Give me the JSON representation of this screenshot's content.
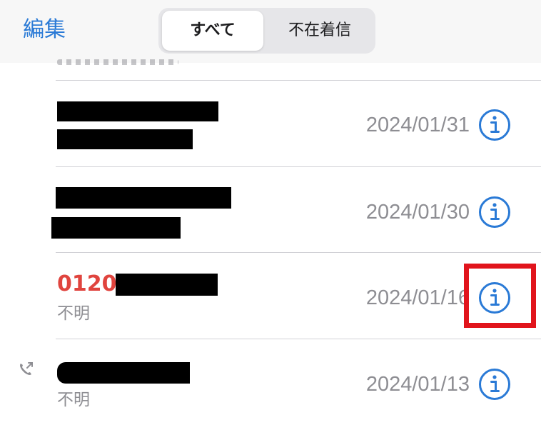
{
  "nav": {
    "edit_label": "編集",
    "segments": [
      "すべて",
      "不在着信"
    ],
    "selected": "すべて"
  },
  "rows": [
    {
      "name": "",
      "subtitle": "",
      "date": "2024/01/31"
    },
    {
      "name": "",
      "subtitle": "",
      "date": "2024/01/30"
    },
    {
      "name": "0120",
      "subtitle": "不明",
      "date": "2024/01/16",
      "missed": true
    },
    {
      "name": "",
      "subtitle": "不明",
      "date": "2024/01/13",
      "outgoing": true
    }
  ],
  "colors": {
    "accent": "#2a7ad6",
    "missed": "#e0443e",
    "secondary_text": "#8e8e93",
    "highlight": "#e1141c"
  },
  "icons": {
    "info": "info-circle-icon",
    "outgoing": "outgoing-call-icon"
  }
}
